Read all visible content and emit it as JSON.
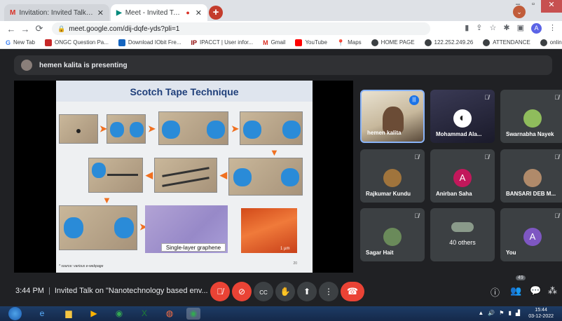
{
  "browser": {
    "tabs": [
      {
        "label": "Invitation: Invited Talk on \"Nano",
        "favicon": "gmail-icon",
        "active": false
      },
      {
        "label": "Meet - Invited Talk on \"Nano",
        "favicon": "meet-icon",
        "active": true
      }
    ],
    "new_tab_label": "+",
    "url": "meet.google.com/dij-dqfe-yds?pli=1",
    "bookmarks": [
      {
        "label": "New Tab"
      },
      {
        "label": "ONGC Question Pa..."
      },
      {
        "label": "Download IObit Fre..."
      },
      {
        "label": "IPACCT | User infor..."
      },
      {
        "label": "Gmail"
      },
      {
        "label": "YouTube"
      },
      {
        "label": "Maps"
      },
      {
        "label": "HOME PAGE"
      },
      {
        "label": "122.252.249.26"
      },
      {
        "label": "ATTENDANCE"
      },
      {
        "label": "online marks"
      }
    ],
    "profile_initial": "A"
  },
  "meet": {
    "presenting_text": "hemen kalita is presenting",
    "slide": {
      "title": "Scotch Tape Technique",
      "graphene_label": "Single-layer graphene",
      "scale_label": "1 µm",
      "source": "* source: various e-webpage",
      "page_num": "20"
    },
    "participants": [
      {
        "name": "hemen kalita",
        "initial": "",
        "speaking": true
      },
      {
        "name": "Mohammad Ala...",
        "initial": ""
      },
      {
        "name": "Swarnabha Nayek",
        "initial": ""
      },
      {
        "name": "Rajkumar Kundu",
        "initial": ""
      },
      {
        "name": "Anirban Saha",
        "initial": "A"
      },
      {
        "name": "BANSARI DEB M...",
        "initial": ""
      },
      {
        "name": "Sagar Hait",
        "initial": ""
      },
      {
        "name": "40 others",
        "initial": ""
      },
      {
        "name": "You",
        "initial": "A"
      }
    ],
    "time": "3:44 PM",
    "meeting_title": "Invited Talk on \"Nanotechnology based env...",
    "participant_count": "49"
  },
  "taskbar": {
    "clock_time": "15:44",
    "clock_date": "03-12-2022"
  },
  "colors": {
    "meet_bg": "#202124",
    "tile_bg": "#3c4043",
    "danger_red": "#ea4335",
    "accent_blue": "#8ab4f8",
    "slide_title_blue": "#1f3f7a"
  }
}
